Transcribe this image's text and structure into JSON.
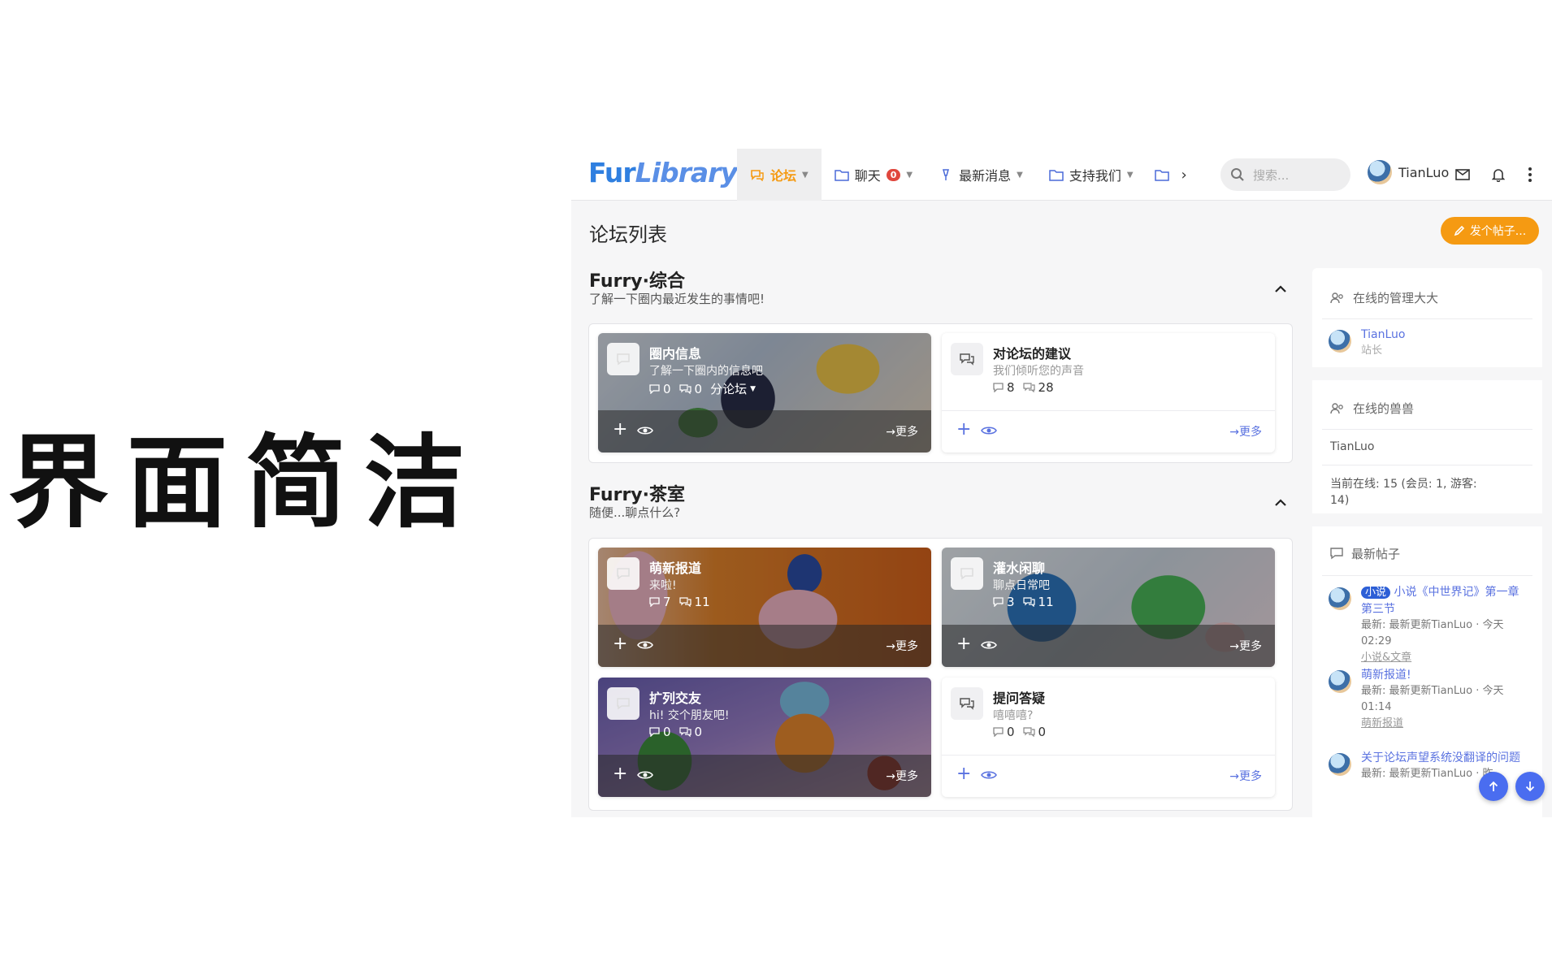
{
  "caption": "界面简洁",
  "header": {
    "logo_fur": "Fur",
    "logo_library": "Library",
    "nav": [
      {
        "label": "论坛",
        "icon": "forum-icon"
      },
      {
        "label": "聊天",
        "icon": "folder-icon",
        "badge": "0"
      },
      {
        "label": "最新消息",
        "icon": "lamp-icon"
      },
      {
        "label": "支持我们",
        "icon": "folder-icon"
      }
    ],
    "search_placeholder": "搜索...",
    "username": "TianLuo"
  },
  "page": {
    "title": "论坛列表",
    "new_post_label": "发个帖子..."
  },
  "categories": [
    {
      "title": "Furry·综合",
      "subtitle": "了解一下圈内最近发生的事情吧!",
      "forums": [
        {
          "name": "圈内信息",
          "desc": "了解一下圈内的信息吧",
          "posts": "0",
          "replies": "0",
          "extra": "分论坛",
          "more": "更多",
          "style": "image"
        },
        {
          "name": "对论坛的建议",
          "desc": "我们倾听您的声音",
          "posts": "8",
          "replies": "28",
          "more": "更多",
          "style": "plain"
        }
      ]
    },
    {
      "title": "Furry·茶室",
      "subtitle": "随便...聊点什么?",
      "forums": [
        {
          "name": "萌新报道",
          "desc": "来啦!",
          "posts": "7",
          "replies": "11",
          "more": "更多",
          "style": "image"
        },
        {
          "name": "灌水闲聊",
          "desc": "聊点日常吧",
          "posts": "3",
          "replies": "11",
          "more": "更多",
          "style": "image"
        },
        {
          "name": "扩列交友",
          "desc": "hi! 交个朋友吧!",
          "posts": "0",
          "replies": "0",
          "more": "更多",
          "style": "image"
        },
        {
          "name": "提问答疑",
          "desc": "嘻嘻嘻?",
          "posts": "0",
          "replies": "0",
          "more": "更多",
          "style": "plain"
        }
      ]
    }
  ],
  "sidebar": {
    "admins_title": "在线的管理大大",
    "admin": {
      "name": "TianLuo",
      "role": "站长"
    },
    "online_title": "在线的兽兽",
    "online_user": "TianLuo",
    "online_stats": "当前在线: 15 (会员: 1, 游客: 14)",
    "latest_title": "最新帖子",
    "posts": [
      {
        "tag": "小说",
        "title": "小说《中世界记》第一章第三节",
        "meta": "最新: 最新更新TianLuo · 今天 02:29",
        "category": "小说&文章"
      },
      {
        "title": "萌新报道!",
        "meta": "最新: 最新更新TianLuo · 今天 01:14",
        "category": "萌新报道"
      },
      {
        "title": "关于论坛声望系统没翻译的问题",
        "meta": "最新: 最新更新TianLuo · 昨"
      }
    ]
  },
  "colors": {
    "accent": "#f59a12",
    "link": "#5a72e0",
    "badge": "#e0473d",
    "logo": "#2f7fe0"
  }
}
